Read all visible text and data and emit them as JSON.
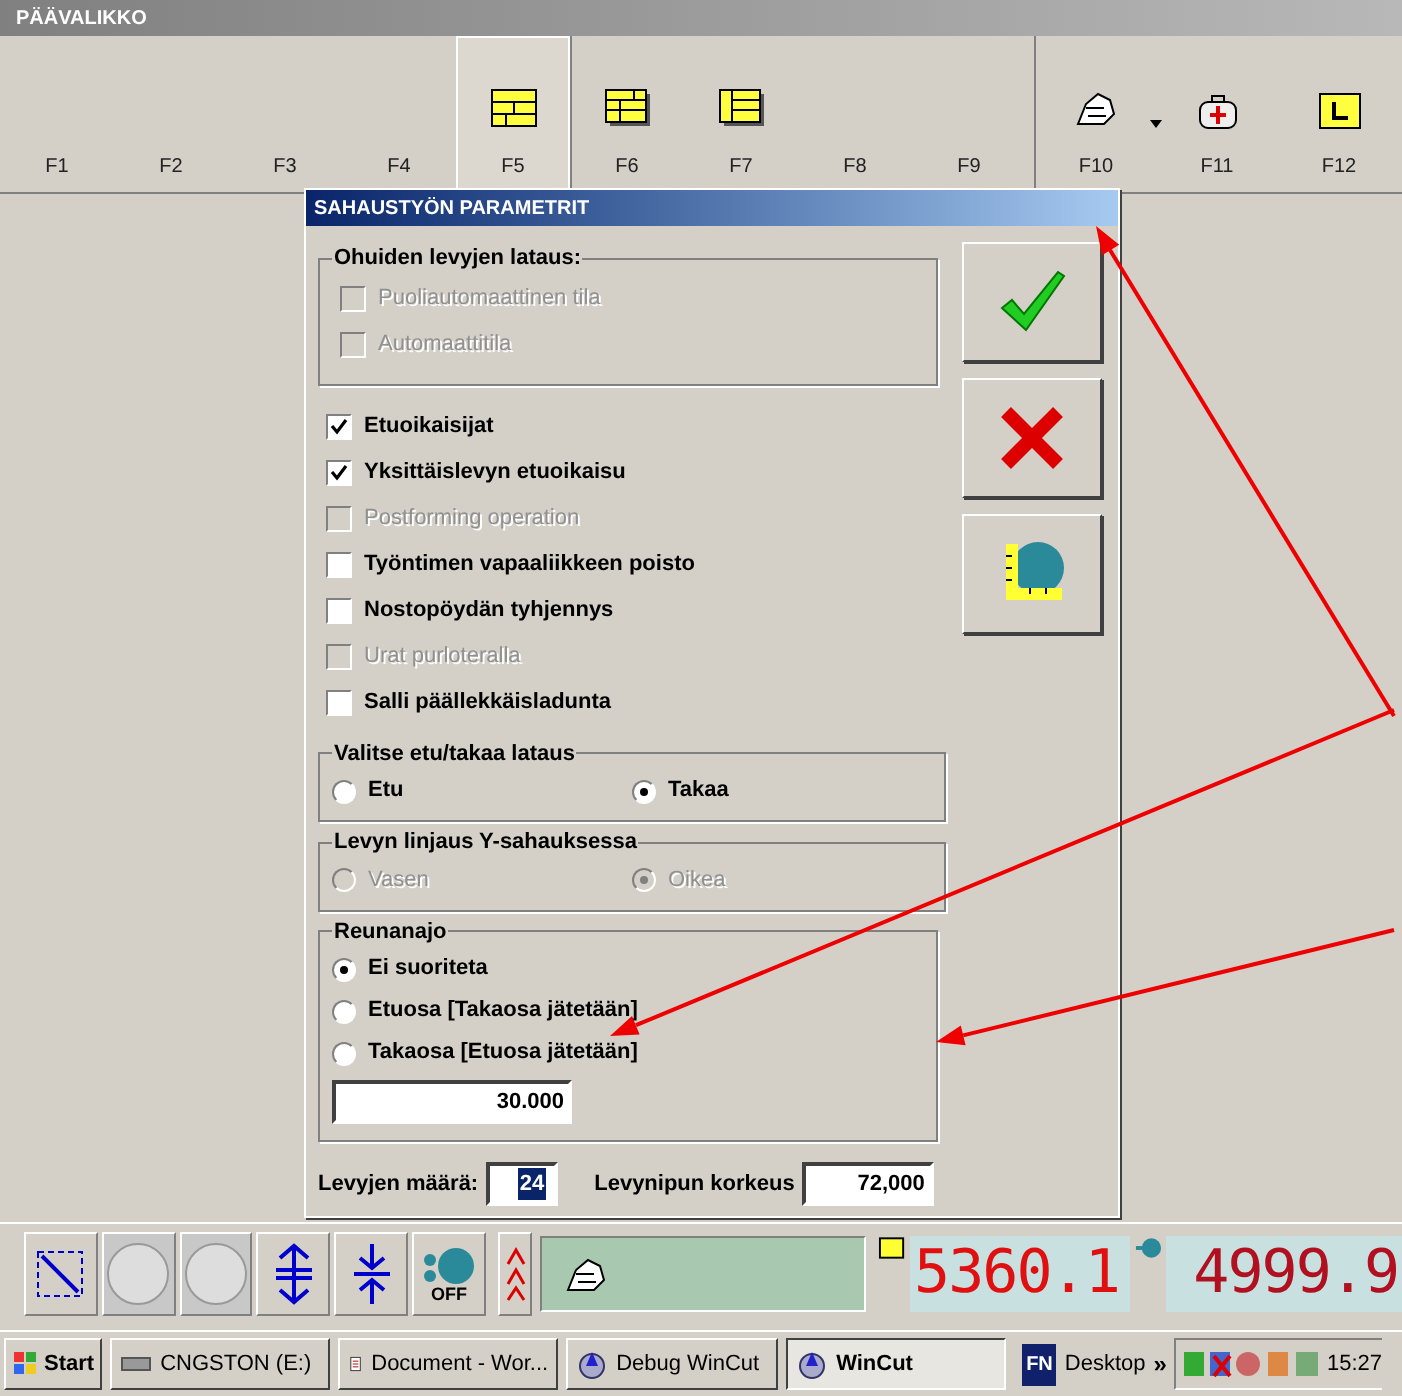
{
  "window": {
    "title": "PÄÄVALIKKO"
  },
  "toolbar": {
    "keys": [
      {
        "label": "F1",
        "kind": "blank",
        "selected": false
      },
      {
        "label": "F2",
        "kind": "blank",
        "selected": false
      },
      {
        "label": "F3",
        "kind": "blank",
        "selected": false
      },
      {
        "label": "F4",
        "kind": "blank",
        "selected": false
      },
      {
        "label": "F5",
        "kind": "panel_a",
        "selected": true
      },
      {
        "label": "F6",
        "kind": "panel_b",
        "selected": false
      },
      {
        "label": "F7",
        "kind": "panel_c",
        "selected": false
      },
      {
        "label": "F8",
        "kind": "blank",
        "selected": false
      },
      {
        "label": "F9",
        "kind": "blank",
        "selected": false
      },
      {
        "label": "F10",
        "kind": "hand",
        "selected": false,
        "dropdown": true
      },
      {
        "label": "F11",
        "kind": "bag",
        "selected": false
      },
      {
        "label": "F12",
        "kind": "box",
        "selected": false
      }
    ]
  },
  "dialog": {
    "title": "SAHAUSTYÖN PARAMETRIT",
    "thin_loading": {
      "legend": "Ohuiden levyjen lataus:",
      "options": [
        {
          "label": "Puoliautomaattinen tila",
          "checked": false,
          "disabled": true
        },
        {
          "label": "Automaattitila",
          "checked": false,
          "disabled": true
        }
      ]
    },
    "options": [
      {
        "label": "Etuoikaisijat",
        "checked": true,
        "disabled": false
      },
      {
        "label": "Yksittäislevyn etuoikaisu",
        "checked": true,
        "disabled": false
      },
      {
        "label": "Postforming operation",
        "checked": false,
        "disabled": true
      },
      {
        "label": "Työntimen vapaaliikkeen poisto",
        "checked": false,
        "disabled": false
      },
      {
        "label": "Nostopöydän tyhjennys",
        "checked": false,
        "disabled": false
      },
      {
        "label": "Urat purloteralla",
        "checked": false,
        "disabled": true
      },
      {
        "label": "Salli päällekkäisladunta",
        "checked": false,
        "disabled": false
      }
    ],
    "load_side": {
      "legend": "Valitse etu/takaa lataus",
      "options": [
        {
          "label": "Etu",
          "selected": false,
          "disabled": false
        },
        {
          "label": "Takaa",
          "selected": true,
          "disabled": false
        }
      ]
    },
    "alignment": {
      "legend": "Levyn linjaus Y-sahauksessa",
      "options": [
        {
          "label": "Vasen",
          "selected": false,
          "disabled": true
        },
        {
          "label": "Oikea",
          "selected": true,
          "disabled": true
        }
      ]
    },
    "trim": {
      "legend": "Reunanajo",
      "options": [
        {
          "label": "Ei suoriteta",
          "selected": true,
          "disabled": false
        },
        {
          "label": "Etuosa [Takaosa jätetään]",
          "selected": false,
          "disabled": false
        },
        {
          "label": "Takaosa [Etuosa jätetään]",
          "selected": false,
          "disabled": false
        }
      ],
      "value": "30.000"
    },
    "sheet_count": {
      "label": "Levyjen määrä:",
      "value": "24"
    },
    "stack_height": {
      "label": "Levynipun korkeus",
      "value": "72,000"
    },
    "buttons": [
      {
        "kind": "ok"
      },
      {
        "kind": "cancel"
      },
      {
        "kind": "tool"
      }
    ]
  },
  "status_bar": {
    "buttons": [
      {
        "kind": "frame",
        "disabled": false
      },
      {
        "kind": "round",
        "disabled": true
      },
      {
        "kind": "round",
        "disabled": true
      },
      {
        "kind": "expand",
        "disabled": false
      },
      {
        "kind": "compress",
        "disabled": false
      },
      {
        "kind": "gear",
        "disabled": false,
        "label": "OFF"
      }
    ],
    "readout_1": "5360.1",
    "readout_2": "4999.9"
  },
  "taskbar": {
    "start": "Start",
    "items": [
      {
        "label": "CNGSTON (E:)",
        "kind": "drive",
        "selected": false
      },
      {
        "label": "Document - Wor...",
        "kind": "doc",
        "selected": false
      },
      {
        "label": "Debug WinCut",
        "kind": "app",
        "selected": false
      },
      {
        "label": "WinCut",
        "kind": "app",
        "selected": true
      }
    ],
    "badge": "FN",
    "desktop": "Desktop",
    "chevron": "»",
    "clock": "15:27"
  }
}
